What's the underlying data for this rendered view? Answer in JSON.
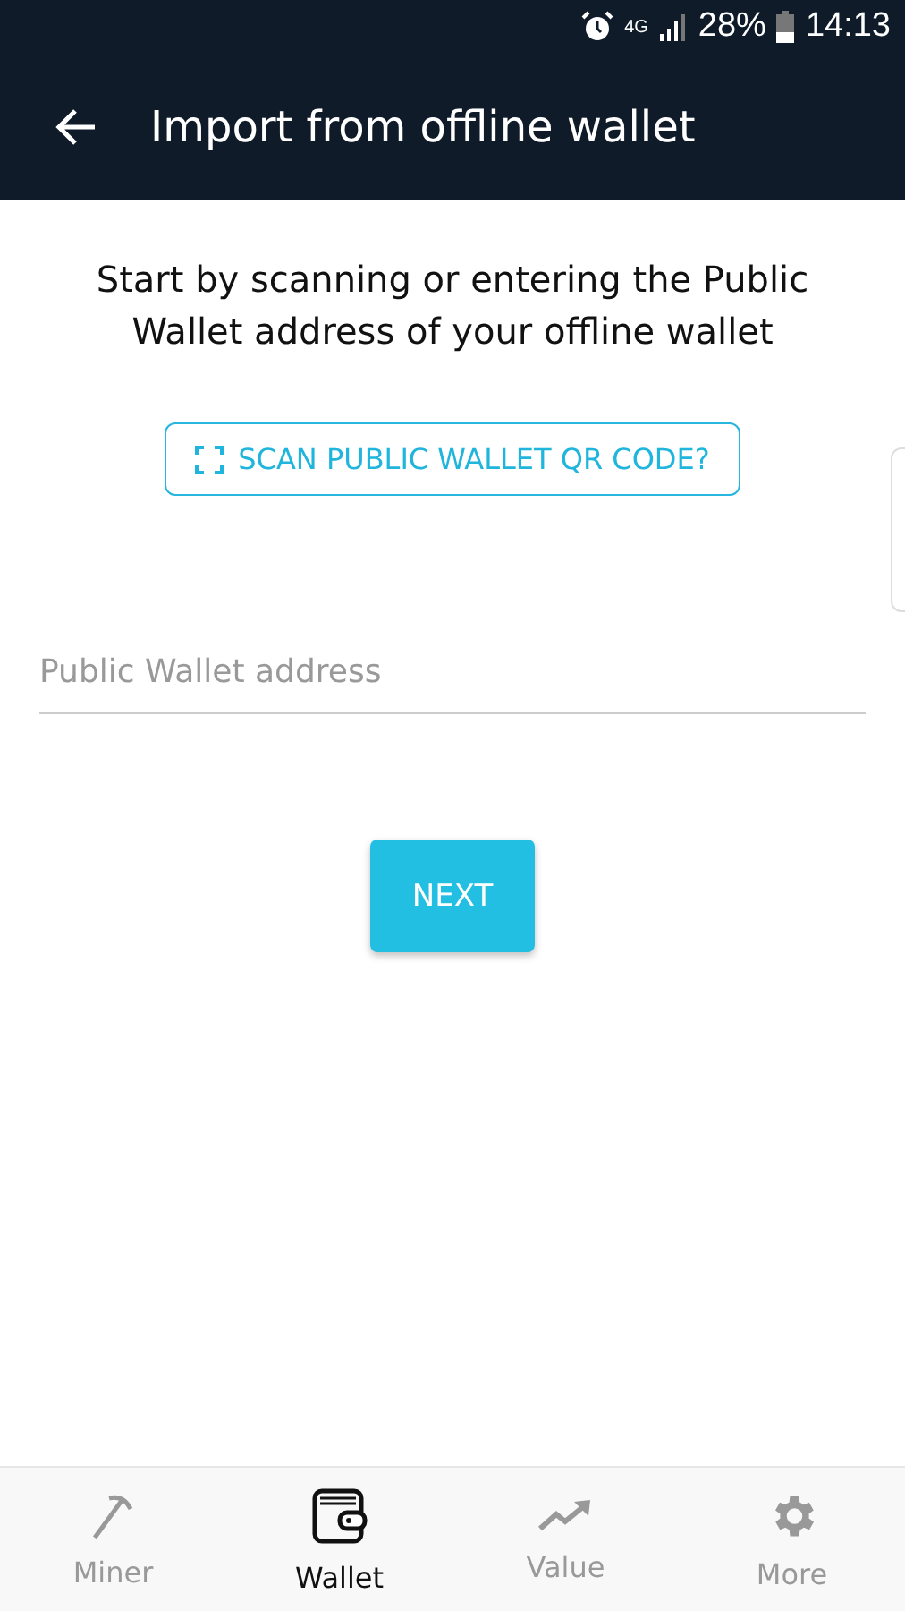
{
  "status_bar": {
    "network": "4G",
    "battery": "28%",
    "time": "14:13"
  },
  "app_bar": {
    "title": "Import from offline wallet"
  },
  "intro": "Start by scanning or entering the Public Wallet address of your offline wallet",
  "scan_button": {
    "label": "SCAN PUBLIC WALLET QR CODE?"
  },
  "address_field": {
    "placeholder": "Public Wallet address"
  },
  "next_button": {
    "label": "NEXT"
  },
  "bottom_nav": [
    {
      "kind": "miner",
      "label": "Miner",
      "selected": false
    },
    {
      "kind": "wallet",
      "label": "Wallet",
      "selected": true
    },
    {
      "kind": "value",
      "label": "Value",
      "selected": false
    },
    {
      "kind": "more",
      "label": "More",
      "selected": false
    }
  ]
}
